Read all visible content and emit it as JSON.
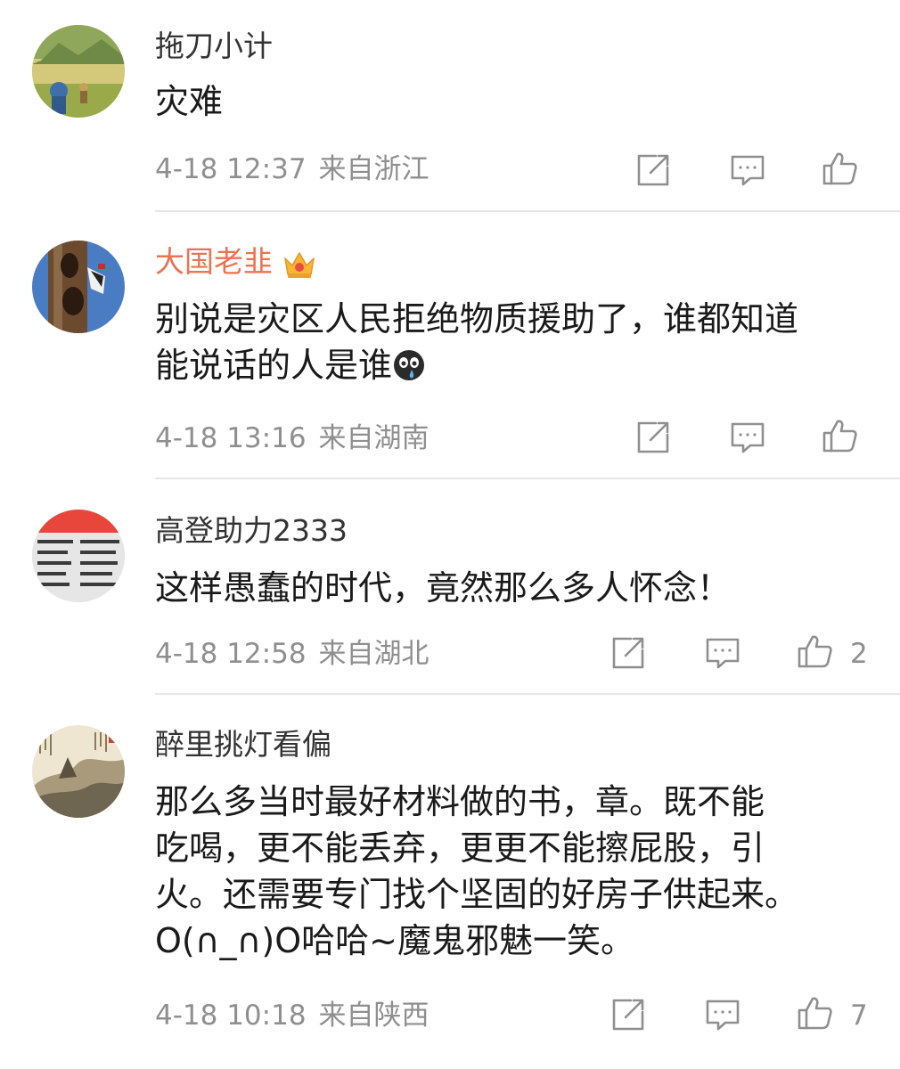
{
  "comments": [
    {
      "username": "拖刀小计",
      "text_lines": [
        "灾难"
      ],
      "date": "4-18 12:37",
      "location": "来自浙江",
      "likes": ""
    },
    {
      "username": "大国老韭",
      "vip": true,
      "text_lines": [
        "别说是灾区人民拒绝物质援助了，谁都知道",
        "能说话的人是谁"
      ],
      "emoji": "crying-emoji",
      "date": "4-18 13:16",
      "location": "来自湖南",
      "likes": ""
    },
    {
      "username": "高登助力2333",
      "text_lines": [
        "这样愚蠢的时代，竟然那么多人怀念！"
      ],
      "date": "4-18 12:58",
      "location": "来自湖北",
      "likes": "2"
    },
    {
      "username": "醉里挑灯看偏",
      "text_lines": [
        "那么多当时最好材料做的书，章。既不能",
        "吃喝，更不能丢弃，更更不能擦屁股，引",
        "火。还需要专门找个坚固的好房子供起来。",
        "O(∩_∩)O哈哈~魔鬼邪魅一笑。"
      ],
      "date": "4-18 10:18",
      "location": "来自陕西",
      "likes": "7"
    }
  ],
  "colors": {
    "vip_name": "#eb7350",
    "meta_text": "#8f8f8f",
    "divider": "#e6e6e6",
    "icon_stroke": "#8f8f8f"
  }
}
